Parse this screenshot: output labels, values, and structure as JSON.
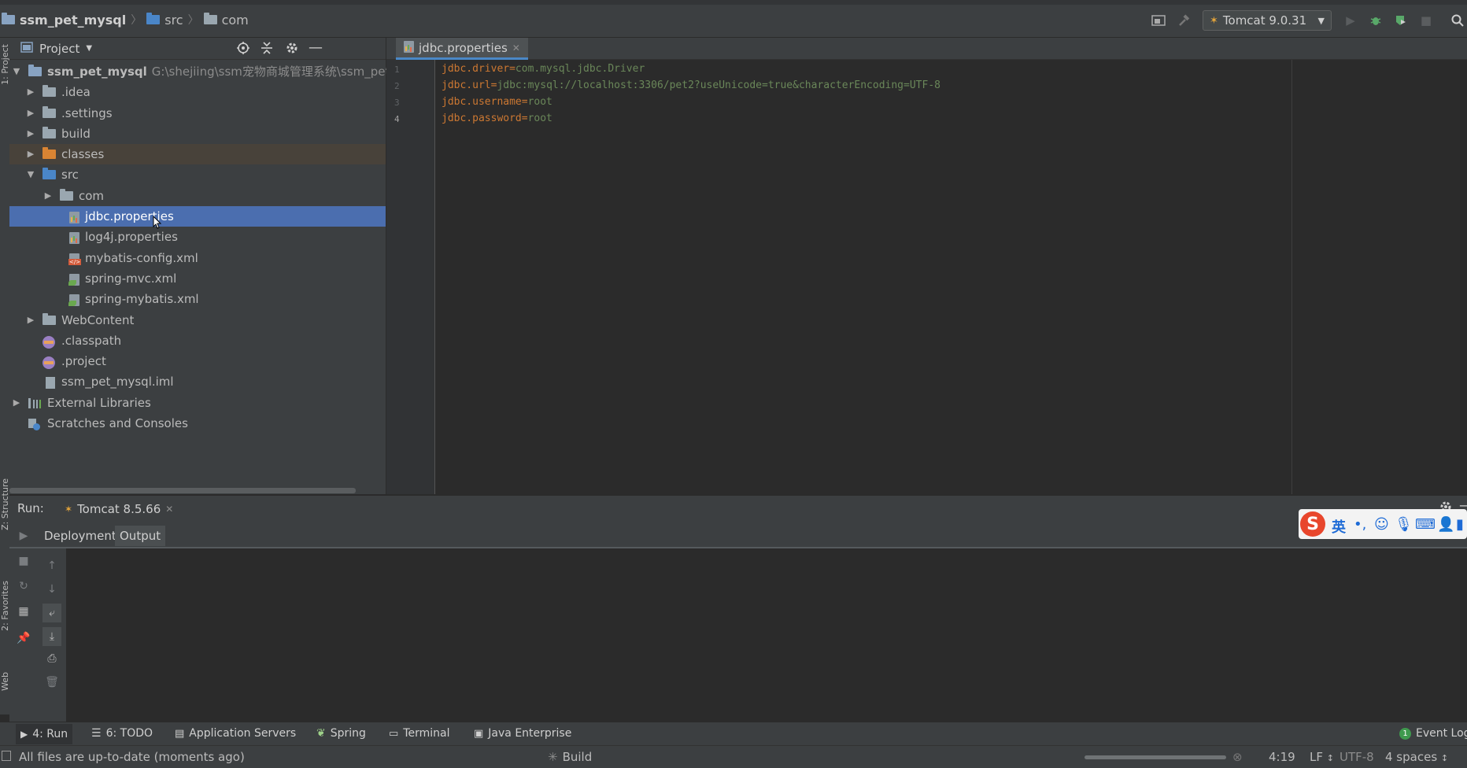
{
  "breadcrumb": {
    "project": "ssm_pet_mysql",
    "folder1": "src",
    "folder2": "com"
  },
  "toolbar": {
    "run_config": "Tomcat 9.0.31"
  },
  "project_panel": {
    "title": "Project",
    "root_label": "ssm_pet_mysql",
    "root_path": "G:\\shejiing\\ssm宠物商城管理系统\\ssm_pet_r",
    "items": [
      {
        "label": ".idea"
      },
      {
        "label": ".settings"
      },
      {
        "label": "build"
      },
      {
        "label": "classes"
      },
      {
        "label": "src"
      },
      {
        "label": "com"
      },
      {
        "label": "jdbc.properties"
      },
      {
        "label": "log4j.properties"
      },
      {
        "label": "mybatis-config.xml"
      },
      {
        "label": "spring-mvc.xml"
      },
      {
        "label": "spring-mybatis.xml"
      },
      {
        "label": "WebContent"
      },
      {
        "label": ".classpath"
      },
      {
        "label": ".project"
      },
      {
        "label": "ssm_pet_mysql.iml"
      },
      {
        "label": "External Libraries"
      },
      {
        "label": "Scratches and Consoles"
      }
    ]
  },
  "editor": {
    "tab_label": "jdbc.properties",
    "lines": [
      {
        "num": "1",
        "key": "jdbc.driver",
        "eq": "=",
        "value": "com.mysql.jdbc.Driver"
      },
      {
        "num": "2",
        "key": "jdbc.url",
        "eq": "=",
        "value": "jdbc:mysql://localhost:3306/pet2?useUnicode=true&characterEncoding=UTF-8"
      },
      {
        "num": "3",
        "key": "jdbc.username",
        "eq": "=",
        "value": "root"
      },
      {
        "num": "4",
        "key": "jdbc.password",
        "eq": "=",
        "value": "root"
      }
    ]
  },
  "run_panel": {
    "label": "Run:",
    "config_tab": "Tomcat 8.5.66",
    "subtab_deployment": "Deployment",
    "subtab_output": "Output"
  },
  "left_strip": {
    "project": "1: Project",
    "structure": "Z: Structure",
    "favorites": "2: Favorites",
    "web": "Web"
  },
  "bottom_tabs": {
    "run": "4: Run",
    "todo": "6: TODO",
    "app_servers": "Application Servers",
    "spring": "Spring",
    "terminal": "Terminal",
    "java_enterprise": "Java Enterprise",
    "event_log": "Event Log",
    "event_count": "1"
  },
  "status": {
    "message": "All files are up-to-date (moments ago)",
    "build": "Build",
    "position": "4:19",
    "line_sep": "LF",
    "encoding": "UTF-8",
    "indent": "4 spaces"
  },
  "ime": {
    "logo": "S",
    "lang": "英",
    "punct": "•,"
  },
  "colors": {
    "selection": "#4b6eaf",
    "keyword": "#cc7832",
    "string": "#6a8759",
    "tab_underline": "#4a88c7"
  }
}
